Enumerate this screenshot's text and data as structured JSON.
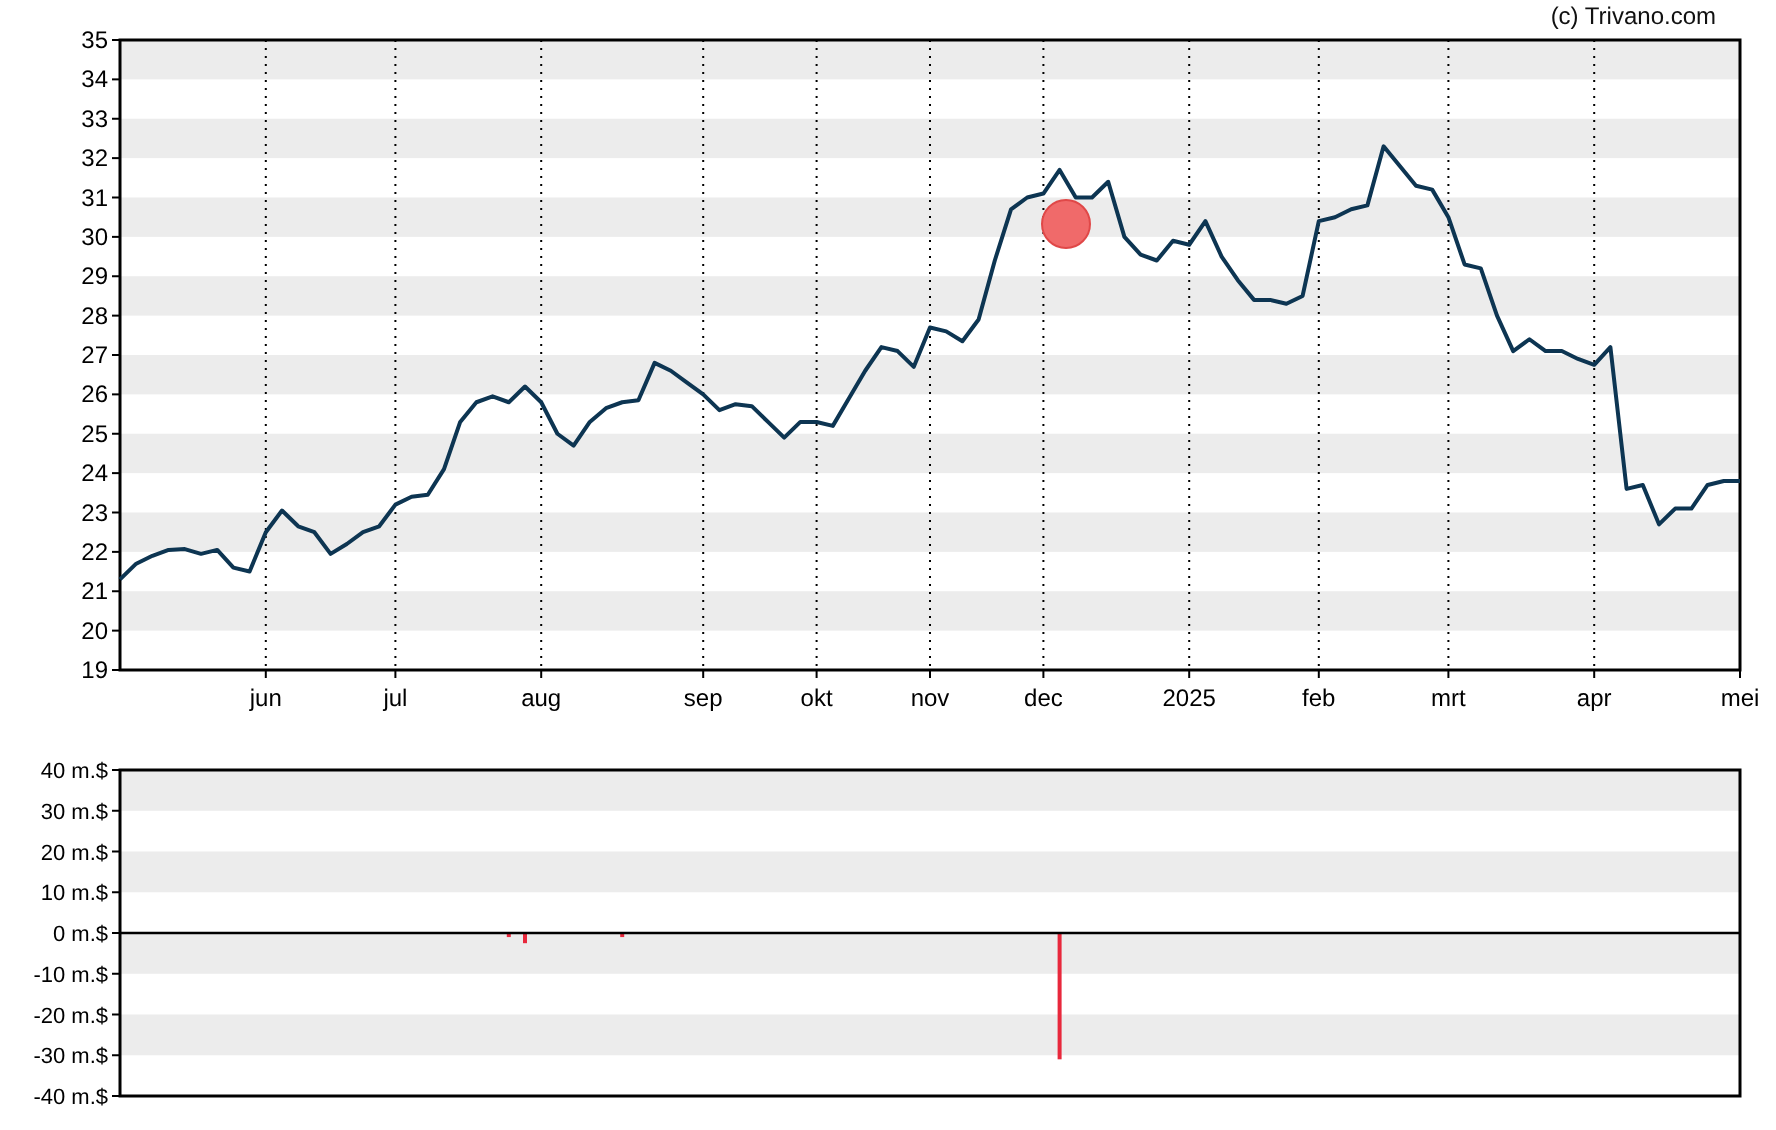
{
  "attribution": "(c) Trivano.com",
  "price_chart": {
    "chart_data": {
      "type": "line",
      "ylim": [
        19,
        35
      ],
      "yticks": [
        19,
        20,
        21,
        22,
        23,
        24,
        25,
        26,
        27,
        28,
        29,
        30,
        31,
        32,
        33,
        34,
        35
      ],
      "categories": [
        null,
        null,
        null,
        null,
        null,
        null,
        null,
        null,
        null,
        "jun",
        null,
        null,
        null,
        null,
        null,
        null,
        null,
        "jul",
        null,
        null,
        null,
        null,
        null,
        null,
        null,
        null,
        "aug",
        null,
        null,
        null,
        null,
        null,
        null,
        null,
        null,
        null,
        "sep",
        null,
        null,
        null,
        null,
        null,
        null,
        "okt",
        null,
        null,
        null,
        null,
        null,
        null,
        "nov",
        null,
        null,
        null,
        null,
        null,
        null,
        "dec",
        null,
        null,
        null,
        null,
        null,
        null,
        null,
        null,
        "2025",
        null,
        null,
        null,
        null,
        null,
        null,
        null,
        "feb",
        null,
        null,
        null,
        null,
        null,
        null,
        null,
        "mrt",
        null,
        null,
        null,
        null,
        null,
        null,
        null,
        null,
        "apr",
        null,
        null,
        null,
        null,
        null,
        null,
        null,
        null,
        "mei"
      ],
      "series": [
        {
          "color": "#0d3552",
          "values": [
            21.3,
            21.7,
            21.9,
            22.05,
            22.07,
            21.95,
            22.05,
            21.6,
            21.5,
            22.5,
            23.05,
            22.65,
            22.5,
            21.95,
            22.2,
            22.5,
            22.65,
            23.2,
            23.4,
            23.45,
            24.1,
            25.3,
            25.8,
            25.95,
            25.8,
            26.2,
            25.8,
            25.0,
            24.7,
            25.3,
            25.65,
            25.8,
            25.85,
            26.8,
            26.6,
            26.3,
            26.0,
            25.6,
            25.75,
            25.7,
            25.3,
            24.9,
            25.3,
            25.3,
            25.2,
            25.9,
            26.6,
            27.2,
            27.1,
            26.7,
            27.7,
            27.6,
            27.35,
            27.9,
            29.4,
            30.7,
            31.0,
            31.1,
            31.7,
            31.0,
            31.0,
            31.4,
            30.0,
            29.55,
            29.4,
            29.9,
            29.8,
            30.4,
            29.5,
            28.9,
            28.4,
            28.4,
            28.3,
            28.5,
            30.4,
            30.5,
            30.7,
            30.8,
            32.3,
            31.8,
            31.3,
            31.2,
            30.5,
            29.3,
            29.2,
            28.0,
            27.1,
            27.4,
            27.1,
            27.1,
            26.9,
            26.75,
            27.2,
            23.6,
            23.7,
            22.7,
            23.1,
            23.1,
            23.7,
            23.8,
            23.8
          ]
        }
      ],
      "grid": true
    }
  },
  "flow_chart": {
    "chart_data": {
      "type": "bar",
      "ylim": [
        -40,
        40
      ],
      "yticks": [
        {
          "value": 40,
          "label": "40 m.$"
        },
        {
          "value": 30,
          "label": "30 m.$"
        },
        {
          "value": 20,
          "label": "20 m.$"
        },
        {
          "value": 10,
          "label": "10 m.$"
        },
        {
          "value": 0,
          "label": "0 m.$"
        },
        {
          "value": -10,
          "label": "-10 m.$"
        },
        {
          "value": -20,
          "label": "-20 m.$"
        },
        {
          "value": -30,
          "label": "-30 m.$"
        },
        {
          "value": -40,
          "label": "-40 m.$"
        }
      ],
      "categories": [
        null,
        null,
        null,
        null,
        null,
        null,
        null,
        null,
        null,
        null,
        null,
        null,
        null,
        null,
        null,
        null,
        null,
        null,
        null,
        null,
        null,
        null,
        null,
        null,
        null,
        null,
        null,
        null,
        null,
        null,
        null,
        null,
        null,
        null,
        null,
        null,
        null,
        null,
        null,
        null,
        null,
        null,
        null,
        null,
        null,
        null,
        null,
        null,
        null,
        null,
        null,
        null,
        null,
        null,
        null,
        null,
        null,
        null,
        null,
        null,
        null,
        null,
        null,
        null,
        null,
        null,
        null,
        null,
        null,
        null,
        null,
        null,
        null,
        null,
        null,
        null,
        null,
        null,
        null,
        null,
        null,
        null,
        null,
        null,
        null,
        null,
        null,
        null,
        null,
        null,
        null,
        null,
        null,
        null,
        null,
        null,
        null,
        null,
        null,
        null,
        null
      ],
      "series": [
        {
          "color": "#e8283c",
          "values": [
            null,
            null,
            null,
            null,
            null,
            null,
            null,
            null,
            null,
            null,
            null,
            null,
            null,
            null,
            null,
            null,
            null,
            null,
            null,
            null,
            null,
            null,
            null,
            null,
            -1,
            -2.5,
            null,
            null,
            null,
            null,
            null,
            -1,
            null,
            null,
            null,
            null,
            null,
            null,
            null,
            null,
            null,
            null,
            null,
            null,
            null,
            null,
            null,
            null,
            null,
            null,
            null,
            null,
            null,
            null,
            null,
            null,
            null,
            null,
            -31,
            null,
            null,
            null,
            null,
            null,
            null,
            null,
            null,
            null,
            null,
            null,
            null,
            null,
            null,
            null,
            null,
            null,
            null,
            null,
            null,
            null,
            null,
            null,
            null,
            null,
            null,
            null,
            null,
            null,
            null,
            null,
            null,
            null,
            null,
            null,
            null,
            null,
            null,
            null,
            null,
            null,
            null
          ]
        }
      ]
    }
  }
}
